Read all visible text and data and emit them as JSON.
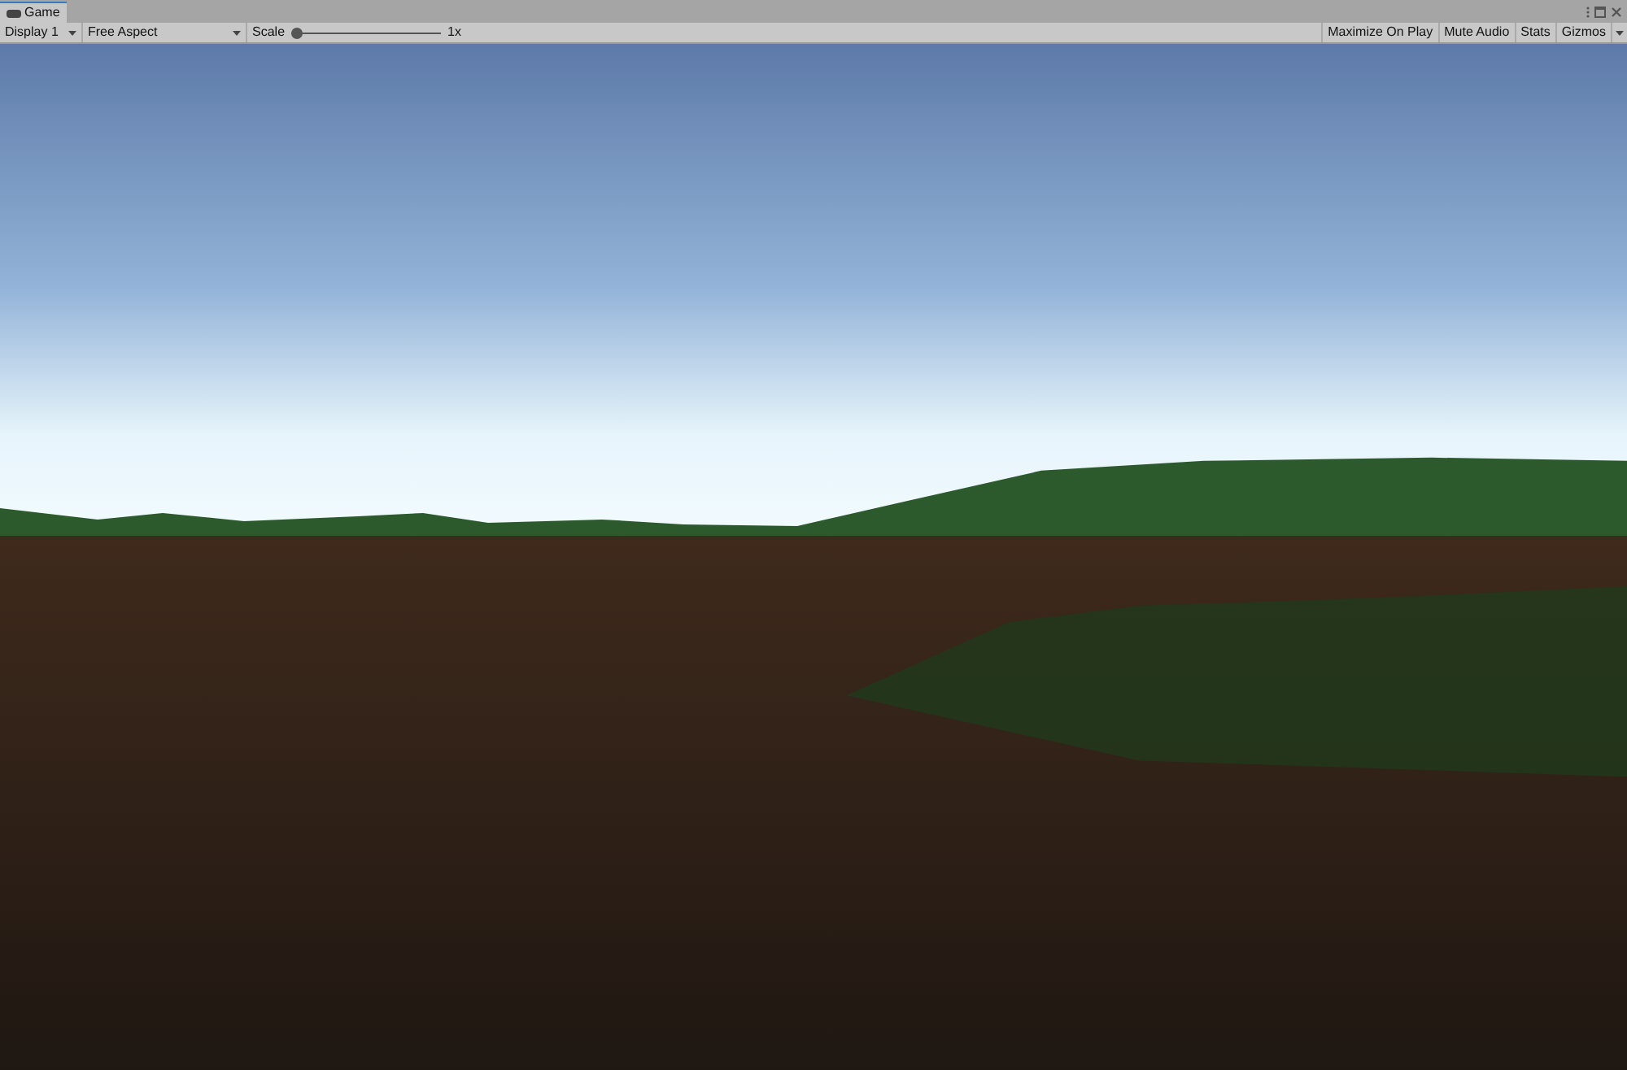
{
  "tab": {
    "label": "Game",
    "selected": true
  },
  "toolbar": {
    "display": "Display 1",
    "aspect": "Free Aspect",
    "scale": {
      "label": "Scale",
      "level": 0,
      "reading": "1x"
    },
    "toggles": [
      {
        "label": "Maximize On Play",
        "on": false
      },
      {
        "label": "Mute Audio",
        "on": false
      },
      {
        "label": "Stats",
        "on": false
      },
      {
        "label": "Gizmos",
        "on": false
      }
    ]
  }
}
